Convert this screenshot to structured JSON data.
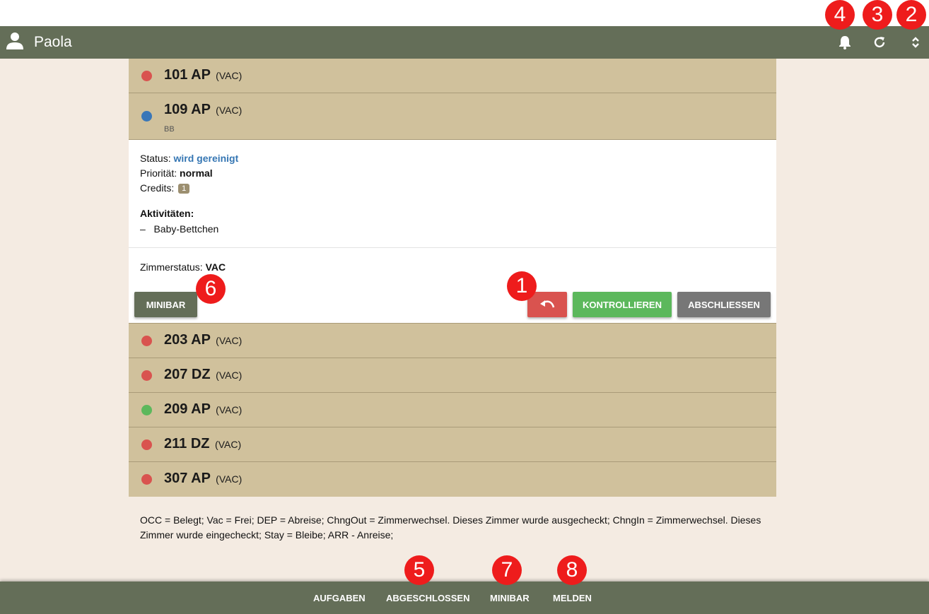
{
  "header": {
    "user_name": "Paola"
  },
  "rooms_top": [
    {
      "number": "101 AP",
      "type": "(VAC)",
      "dot_color": "#d9534f"
    },
    {
      "number": "109 AP",
      "type": "(VAC)",
      "dot_color": "#3a77b8",
      "sub": "BB"
    }
  ],
  "detail": {
    "status_label": "Status:",
    "status_value": "wird gereinigt",
    "priority_label": "Priorität:",
    "priority_value": "normal",
    "credits_label": "Credits:",
    "credits_value": "1",
    "activities_label": "Aktivitäten:",
    "activity_dash": "–",
    "activity_1": "Baby-Bettchen",
    "zimmer_label": "Zimmerstatus:",
    "zimmer_value": "VAC",
    "minibar_button": "MINIBAR",
    "kontrollieren_button": "KONTROLLIEREN",
    "abschliessen_button": "ABSCHLIESSEN"
  },
  "rooms_bottom": [
    {
      "number": "203 AP",
      "type": "(VAC)",
      "dot_color": "#d9534f"
    },
    {
      "number": "207 DZ",
      "type": "(VAC)",
      "dot_color": "#d9534f"
    },
    {
      "number": "209 AP",
      "type": "(VAC)",
      "dot_color": "#5cb85c"
    },
    {
      "number": "211 DZ",
      "type": "(VAC)",
      "dot_color": "#d9534f"
    },
    {
      "number": "307 AP",
      "type": "(VAC)",
      "dot_color": "#d9534f"
    }
  ],
  "legend_text": "OCC = Belegt; Vac = Frei; DEP = Abreise; ChngOut = Zimmerwechsel. Dieses Zimmer wurde ausgecheckt; ChngIn = Zimmerwechsel. Dieses Zimmer wurde eingecheckt; Stay = Bleibe; ARR - Anreise;",
  "footer": {
    "aufgaben": "AUFGABEN",
    "abgeschlossen": "ABGESCHLOSSEN",
    "minibar": "MINIBAR",
    "melden": "MELDEN"
  },
  "markers": [
    "1",
    "2",
    "3",
    "4",
    "5",
    "6",
    "7",
    "8"
  ],
  "colors": {
    "header_bg": "#646e58",
    "room_bg": "#d0c19c",
    "page_bg": "#f4ebe2",
    "status_blue": "#3576b3",
    "red": "#d9534f",
    "green": "#5cb85c",
    "grey": "#777777",
    "marker_red": "#ee1c1c"
  }
}
